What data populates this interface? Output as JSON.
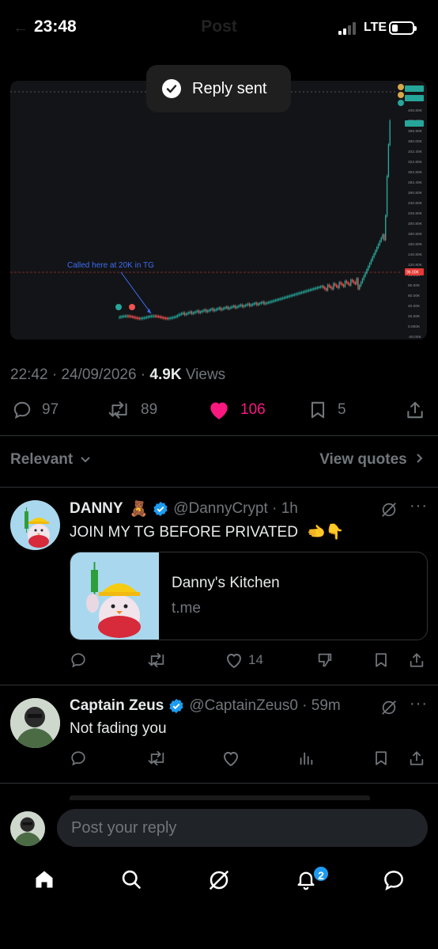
{
  "status_bar": {
    "time": "23:48",
    "network": "LTE",
    "battery_level": 0.2
  },
  "header": {
    "title": "Post"
  },
  "toast": {
    "text": "Reply sent"
  },
  "chart_image": {
    "annotation": "Called here at 20K in TG",
    "price_tags": [
      "421.60K",
      "420.90K",
      "406.80K",
      "385.90K",
      "365.90K",
      "360.00K",
      "342.40K",
      "322.80K",
      "302.80K",
      "282.40K",
      "260.80K",
      "240.80K",
      "225.80K",
      "200.80K",
      "180.80K",
      "160.80K",
      "140.80K",
      "120.80K",
      "96.00K",
      "80.00K",
      "60.00K",
      "40.00K",
      "20.00K",
      "0.000K",
      "-20.00K"
    ],
    "highlight_tag": "96.00K",
    "colors": {
      "up": "#26a69a",
      "down": "#ef5350",
      "annotation": "#3d6df2"
    }
  },
  "post": {
    "time": "22:42",
    "date": "24/09/2026",
    "views_count": "4.9K",
    "views_label": "Views",
    "replies": "97",
    "reposts": "89",
    "likes": "106",
    "bookmarks": "5"
  },
  "sort": {
    "label": "Relevant",
    "quotes_label": "View quotes"
  },
  "replies": [
    {
      "name": "DANNY",
      "name_emoji": "🧸",
      "handle": "@DannyCrypt",
      "time": "1h",
      "text": "JOIN MY TG BEFORE PRIVATED",
      "text_emoji": "🫲👇",
      "card": {
        "title": "Danny's Kitchen",
        "domain": "t.me"
      },
      "likes": "14"
    },
    {
      "name": "Captain Zeus",
      "handle": "@CaptainZeus0",
      "time": "59m",
      "text": "Not fading you"
    }
  ],
  "compose": {
    "placeholder": "Post your reply"
  },
  "tabs": {
    "notifications_badge": "2"
  },
  "colors": {
    "like": "#f91880",
    "verified": "#1d9bf0",
    "muted": "#71767b"
  }
}
